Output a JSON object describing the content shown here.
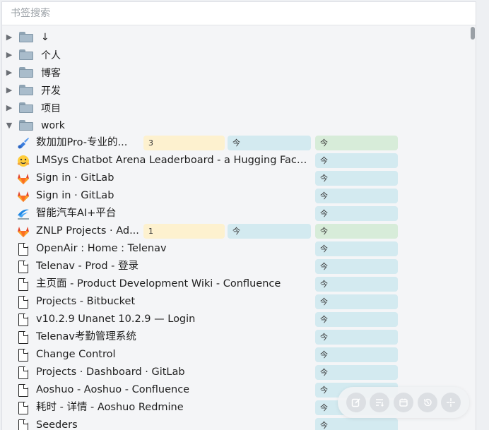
{
  "search": {
    "placeholder": "书签搜索"
  },
  "folders": [
    {
      "label": "↓",
      "expanded": false
    },
    {
      "label": "个人",
      "expanded": false
    },
    {
      "label": "博客",
      "expanded": false
    },
    {
      "label": "开发",
      "expanded": false
    },
    {
      "label": "项目",
      "expanded": false
    },
    {
      "label": "work",
      "expanded": true
    }
  ],
  "bookmarks": [
    {
      "title": "数加加Pro-专业的...",
      "icon": "brush-icon",
      "chips": {
        "y": "3",
        "b": "今",
        "g": "今"
      }
    },
    {
      "title": "LMSys Chatbot Arena Leaderboard - a Hugging Face...",
      "icon": "hugging-face-icon",
      "chips": {
        "b2": "今"
      }
    },
    {
      "title": "Sign in · GitLab",
      "icon": "gitlab-icon",
      "chips": {
        "b2": "今"
      }
    },
    {
      "title": "Sign in · GitLab",
      "icon": "gitlab-icon",
      "chips": {
        "b2": "今"
      }
    },
    {
      "title": "智能汽车AI+平台",
      "icon": "ai-platform-icon",
      "chips": {
        "b2": "今"
      }
    },
    {
      "title": "ZNLP Projects · Ad...",
      "icon": "gitlab-icon",
      "chips": {
        "y": "1",
        "b": "今",
        "g": "今"
      }
    },
    {
      "title": "OpenAir : Home : Telenav",
      "icon": "document-icon",
      "chips": {
        "b2": "今"
      }
    },
    {
      "title": "Telenav - Prod - 登录",
      "icon": "document-icon",
      "chips": {
        "b2": "今"
      }
    },
    {
      "title": "主页面 - Product Development Wiki - Confluence",
      "icon": "document-icon",
      "chips": {
        "b2": "今"
      }
    },
    {
      "title": "Projects - Bitbucket",
      "icon": "document-icon",
      "chips": {
        "b2": "今"
      }
    },
    {
      "title": "v10.2.9 Unanet 10.2.9 — Login",
      "icon": "document-icon",
      "chips": {
        "b2": "今"
      }
    },
    {
      "title": "Telenav考勤管理系统",
      "icon": "document-icon",
      "chips": {
        "b2": "今"
      }
    },
    {
      "title": "Change Control",
      "icon": "document-icon",
      "chips": {
        "b2": "今"
      }
    },
    {
      "title": "Projects · Dashboard · GitLab",
      "icon": "document-icon",
      "chips": {
        "b2": "今"
      }
    },
    {
      "title": "Aoshuo - Aoshuo - Confluence",
      "icon": "document-icon",
      "chips": {
        "b2": "今"
      }
    },
    {
      "title": "耗时 - 详情 - Aoshuo Redmine",
      "icon": "document-icon",
      "chips": {
        "b2": "今"
      }
    },
    {
      "title": "Seeders",
      "icon": "document-icon",
      "chips": {
        "b2": "今"
      }
    }
  ],
  "toolbar": {
    "buttons": [
      "edit-icon",
      "sort-icon",
      "calendar-icon",
      "history-icon",
      "locate-icon"
    ]
  },
  "colors": {
    "chip_yellow": "#fdf1cf",
    "chip_blue": "#d3eaf0",
    "chip_green": "#d7ecd9",
    "gitlab_orange": "#e24329"
  }
}
